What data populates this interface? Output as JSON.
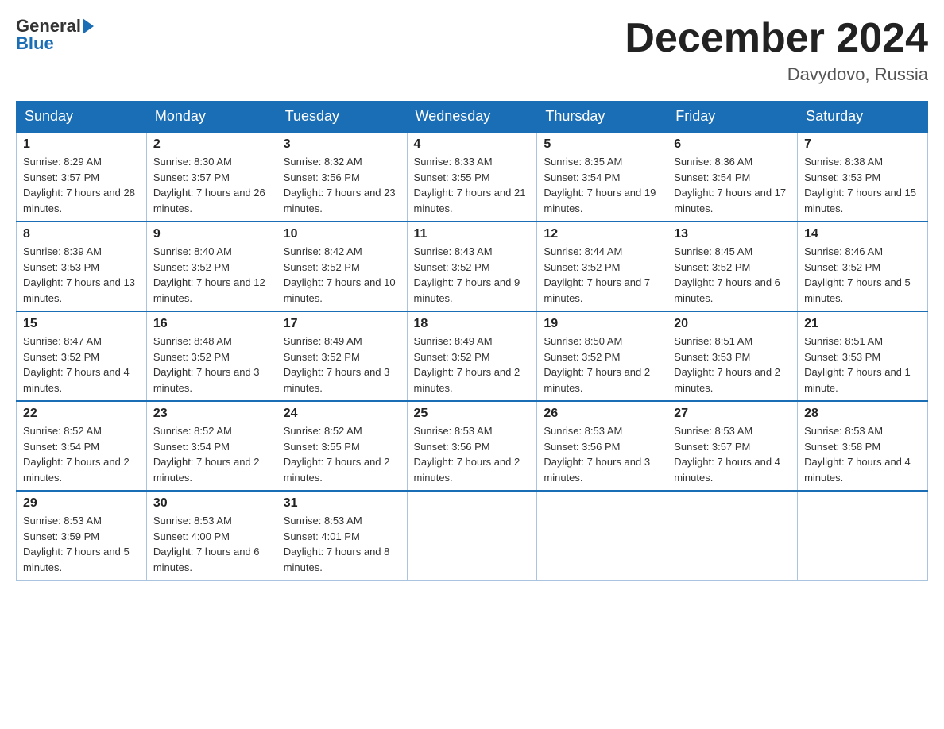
{
  "header": {
    "logo": {
      "general": "General",
      "blue": "Blue"
    },
    "title": "December 2024",
    "location": "Davydovo, Russia"
  },
  "days_of_week": [
    "Sunday",
    "Monday",
    "Tuesday",
    "Wednesday",
    "Thursday",
    "Friday",
    "Saturday"
  ],
  "weeks": [
    [
      {
        "day": "1",
        "sunrise": "8:29 AM",
        "sunset": "3:57 PM",
        "daylight": "7 hours and 28 minutes."
      },
      {
        "day": "2",
        "sunrise": "8:30 AM",
        "sunset": "3:57 PM",
        "daylight": "7 hours and 26 minutes."
      },
      {
        "day": "3",
        "sunrise": "8:32 AM",
        "sunset": "3:56 PM",
        "daylight": "7 hours and 23 minutes."
      },
      {
        "day": "4",
        "sunrise": "8:33 AM",
        "sunset": "3:55 PM",
        "daylight": "7 hours and 21 minutes."
      },
      {
        "day": "5",
        "sunrise": "8:35 AM",
        "sunset": "3:54 PM",
        "daylight": "7 hours and 19 minutes."
      },
      {
        "day": "6",
        "sunrise": "8:36 AM",
        "sunset": "3:54 PM",
        "daylight": "7 hours and 17 minutes."
      },
      {
        "day": "7",
        "sunrise": "8:38 AM",
        "sunset": "3:53 PM",
        "daylight": "7 hours and 15 minutes."
      }
    ],
    [
      {
        "day": "8",
        "sunrise": "8:39 AM",
        "sunset": "3:53 PM",
        "daylight": "7 hours and 13 minutes."
      },
      {
        "day": "9",
        "sunrise": "8:40 AM",
        "sunset": "3:52 PM",
        "daylight": "7 hours and 12 minutes."
      },
      {
        "day": "10",
        "sunrise": "8:42 AM",
        "sunset": "3:52 PM",
        "daylight": "7 hours and 10 minutes."
      },
      {
        "day": "11",
        "sunrise": "8:43 AM",
        "sunset": "3:52 PM",
        "daylight": "7 hours and 9 minutes."
      },
      {
        "day": "12",
        "sunrise": "8:44 AM",
        "sunset": "3:52 PM",
        "daylight": "7 hours and 7 minutes."
      },
      {
        "day": "13",
        "sunrise": "8:45 AM",
        "sunset": "3:52 PM",
        "daylight": "7 hours and 6 minutes."
      },
      {
        "day": "14",
        "sunrise": "8:46 AM",
        "sunset": "3:52 PM",
        "daylight": "7 hours and 5 minutes."
      }
    ],
    [
      {
        "day": "15",
        "sunrise": "8:47 AM",
        "sunset": "3:52 PM",
        "daylight": "7 hours and 4 minutes."
      },
      {
        "day": "16",
        "sunrise": "8:48 AM",
        "sunset": "3:52 PM",
        "daylight": "7 hours and 3 minutes."
      },
      {
        "day": "17",
        "sunrise": "8:49 AM",
        "sunset": "3:52 PM",
        "daylight": "7 hours and 3 minutes."
      },
      {
        "day": "18",
        "sunrise": "8:49 AM",
        "sunset": "3:52 PM",
        "daylight": "7 hours and 2 minutes."
      },
      {
        "day": "19",
        "sunrise": "8:50 AM",
        "sunset": "3:52 PM",
        "daylight": "7 hours and 2 minutes."
      },
      {
        "day": "20",
        "sunrise": "8:51 AM",
        "sunset": "3:53 PM",
        "daylight": "7 hours and 2 minutes."
      },
      {
        "day": "21",
        "sunrise": "8:51 AM",
        "sunset": "3:53 PM",
        "daylight": "7 hours and 1 minute."
      }
    ],
    [
      {
        "day": "22",
        "sunrise": "8:52 AM",
        "sunset": "3:54 PM",
        "daylight": "7 hours and 2 minutes."
      },
      {
        "day": "23",
        "sunrise": "8:52 AM",
        "sunset": "3:54 PM",
        "daylight": "7 hours and 2 minutes."
      },
      {
        "day": "24",
        "sunrise": "8:52 AM",
        "sunset": "3:55 PM",
        "daylight": "7 hours and 2 minutes."
      },
      {
        "day": "25",
        "sunrise": "8:53 AM",
        "sunset": "3:56 PM",
        "daylight": "7 hours and 2 minutes."
      },
      {
        "day": "26",
        "sunrise": "8:53 AM",
        "sunset": "3:56 PM",
        "daylight": "7 hours and 3 minutes."
      },
      {
        "day": "27",
        "sunrise": "8:53 AM",
        "sunset": "3:57 PM",
        "daylight": "7 hours and 4 minutes."
      },
      {
        "day": "28",
        "sunrise": "8:53 AM",
        "sunset": "3:58 PM",
        "daylight": "7 hours and 4 minutes."
      }
    ],
    [
      {
        "day": "29",
        "sunrise": "8:53 AM",
        "sunset": "3:59 PM",
        "daylight": "7 hours and 5 minutes."
      },
      {
        "day": "30",
        "sunrise": "8:53 AM",
        "sunset": "4:00 PM",
        "daylight": "7 hours and 6 minutes."
      },
      {
        "day": "31",
        "sunrise": "8:53 AM",
        "sunset": "4:01 PM",
        "daylight": "7 hours and 8 minutes."
      },
      null,
      null,
      null,
      null
    ]
  ]
}
